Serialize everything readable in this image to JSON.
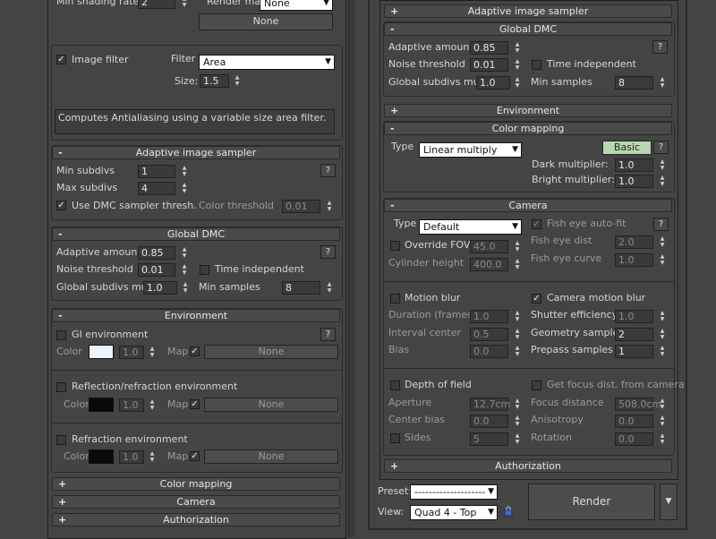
{
  "left": {
    "top": {
      "min_shading_rate_label": "Min shading rate",
      "min_shading_rate_value": "2",
      "render_mask_label": "Render mask",
      "render_mask_value": "None",
      "none_button": "None"
    },
    "image_filter": {
      "checkbox_label": "Image filter",
      "checked": true,
      "filter_label": "Filter",
      "filter_value": "Area",
      "size_label": "Size:",
      "size_value": "1.5",
      "description": "Computes Antialiasing using a variable size area filter."
    },
    "adaptive": {
      "title": "Adaptive image sampler",
      "sign": "-",
      "min_subdivs_label": "Min subdivs",
      "min_subdivs_value": "1",
      "max_subdivs_label": "Max subdivs",
      "max_subdivs_value": "4",
      "dmc_thresh_label": "Use DMC sampler thresh.",
      "color_threshold_label": "Color threshold",
      "color_threshold_value": "0.01",
      "help": "?"
    },
    "global_dmc": {
      "title": "Global DMC",
      "sign": "-",
      "adaptive_amount_label": "Adaptive amount",
      "adaptive_amount_value": "0.85",
      "noise_threshold_label": "Noise threshold",
      "noise_threshold_value": "0.01",
      "time_independent_label": "Time independent",
      "global_subdivs_label": "Global subdivs mult.",
      "global_subdivs_value": "1.0",
      "min_samples_label": "Min samples",
      "min_samples_value": "8",
      "help": "?"
    },
    "environment": {
      "title": "Environment",
      "sign": "-",
      "gi_label": "GI environment",
      "color_label": "Color",
      "gi_mult": "1.0",
      "map_label": "Map",
      "gi_map": "None",
      "refl_label": "Reflection/refraction environment",
      "refl_mult": "1.0",
      "refl_map": "None",
      "refr_label": "Refraction environment",
      "refr_mult": "1.0",
      "refr_map": "None",
      "help": "?"
    },
    "collapsed": [
      {
        "sign": "+",
        "title": "Color mapping"
      },
      {
        "sign": "+",
        "title": "Camera"
      },
      {
        "sign": "+",
        "title": "Authorization"
      }
    ]
  },
  "right": {
    "adaptive": {
      "sign": "+",
      "title": "Adaptive image sampler"
    },
    "global_dmc": {
      "title": "Global DMC",
      "sign": "-",
      "adaptive_amount_label": "Adaptive amount",
      "adaptive_amount_value": "0.85",
      "noise_threshold_label": "Noise threshold",
      "noise_threshold_value": "0.01",
      "time_independent_label": "Time independent",
      "global_subdivs_label": "Global subdivs mult.",
      "global_subdivs_value": "1.0",
      "min_samples_label": "Min samples",
      "min_samples_value": "8",
      "help": "?"
    },
    "environment": {
      "sign": "+",
      "title": "Environment"
    },
    "color_mapping": {
      "title": "Color mapping",
      "sign": "-",
      "type_label": "Type",
      "type_value": "Linear multiply",
      "basic_button": "Basic",
      "help": "?",
      "dark_label": "Dark multiplier:",
      "dark_value": "1.0",
      "bright_label": "Bright multiplier:",
      "bright_value": "1.0"
    },
    "camera": {
      "title": "Camera",
      "sign": "-",
      "type_label": "Type",
      "type_value": "Default",
      "fisheye_auto_label": "Fish eye auto-fit",
      "help": "?",
      "override_fov_label": "Override FOV",
      "override_fov_value": "45.0",
      "fisheye_dist_label": "Fish eye dist",
      "fisheye_dist_value": "2.0",
      "cylinder_height_label": "Cylinder height",
      "cylinder_height_value": "400.0",
      "fisheye_curve_label": "Fish eye curve",
      "fisheye_curve_value": "1.0",
      "motion_blur_label": "Motion blur",
      "camera_motion_blur_label": "Camera motion blur",
      "duration_label": "Duration (frames)",
      "duration_value": "1.0",
      "shutter_label": "Shutter efficiency",
      "shutter_value": "1.0",
      "interval_label": "Interval center",
      "interval_value": "0.5",
      "geometry_label": "Geometry samples",
      "geometry_value": "2",
      "bias_label": "Bias",
      "bias_value": "0.0",
      "prepass_label": "Prepass samples",
      "prepass_value": "1",
      "dof_label": "Depth of field",
      "focus_from_cam_label": "Get focus dist. from camera",
      "aperture_label": "Aperture",
      "aperture_value": "12.7cm",
      "focus_distance_label": "Focus distance",
      "focus_distance_value": "508.0cm",
      "center_bias_label": "Center bias",
      "center_bias_value": "0.0",
      "anisotropy_label": "Anisotropy",
      "anisotropy_value": "0.0",
      "sides_label": "Sides",
      "sides_value": "5",
      "rotation_label": "Rotation",
      "rotation_value": "0.0"
    },
    "authorization": {
      "sign": "+",
      "title": "Authorization"
    },
    "footer": {
      "preset_label": "Preset:",
      "preset_value": "--------------------",
      "view_label": "View:",
      "view_value": "Quad 4 - Top",
      "render_button": "Render"
    }
  },
  "colors": {
    "background": "#444444",
    "basic_button": "#b7d7b0",
    "gi_swatch": "#eef4ff",
    "dark_swatch": "#0a0a0a"
  }
}
